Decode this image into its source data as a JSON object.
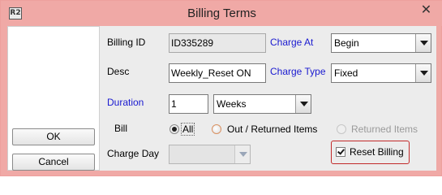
{
  "window": {
    "title": "Billing Terms",
    "icon_text": "R2",
    "close_glyph": "✕"
  },
  "buttons": {
    "ok": "OK",
    "cancel": "Cancel"
  },
  "form": {
    "billing_id_label": "Billing ID",
    "billing_id_value": "ID335289",
    "charge_at_label": "Charge At",
    "charge_at_value": "Begin",
    "desc_label": "Desc",
    "desc_value": "Weekly_Reset ON",
    "charge_type_label": "Charge Type",
    "charge_type_value": "Fixed",
    "duration_label": "Duration",
    "duration_value": "1",
    "duration_unit_value": "Weeks",
    "bill_label": "Bill",
    "bill_options": {
      "all": "All",
      "out_returned": "Out / Returned Items",
      "returned": "Returned Items"
    },
    "bill_selected": "All",
    "charge_day_label": "Charge Day",
    "charge_day_value": "",
    "reset_billing_label": "Reset Billing",
    "reset_billing_checked": true
  },
  "colors": {
    "titlebar": "#f0a9a6",
    "label_blue": "#1a1ad0",
    "highlight_border": "#c22a2a"
  },
  "icons": {
    "app": "r2-app-icon",
    "close": "close-icon",
    "dropdown": "chevron-down-icon",
    "checkbox": "checkmark-icon"
  }
}
